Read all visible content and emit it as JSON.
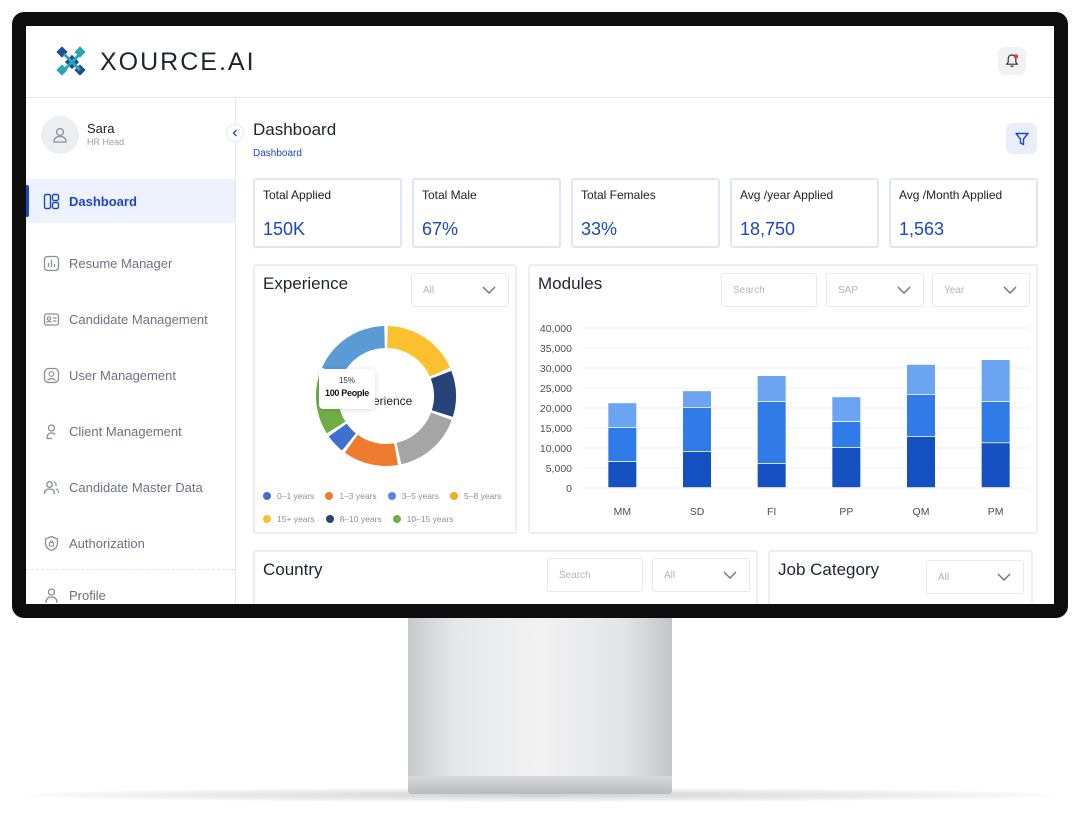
{
  "app": {
    "brand": "XOURCE.AI",
    "colors": {
      "primary": "#1b47c6",
      "logo_dark": "#1d4e8f",
      "logo_teal": "#2aa6b8",
      "notification_dot": "#e53935"
    }
  },
  "header": {
    "notification_icon": "bell-icon"
  },
  "user": {
    "name": "Sara",
    "role": "HR Head"
  },
  "sidebar": {
    "items": [
      {
        "label": "Dashboard",
        "icon": "dashboard-icon",
        "active": true
      },
      {
        "label": "Resume Manager",
        "icon": "chart-document-icon",
        "active": false
      },
      {
        "label": "Candidate Management",
        "icon": "id-card-icon",
        "active": false
      },
      {
        "label": "User Management",
        "icon": "user-circle-icon",
        "active": false
      },
      {
        "label": "Client Management",
        "icon": "user-icon",
        "active": false
      },
      {
        "label": "Candidate Master Data",
        "icon": "users-icon",
        "active": false
      },
      {
        "label": "Authorization",
        "icon": "shield-icon",
        "active": false
      }
    ],
    "profile_label": "Profile"
  },
  "page": {
    "title": "Dashboard",
    "breadcrumb": "Dashboard"
  },
  "stats": [
    {
      "label": "Total Applied",
      "value": "150K"
    },
    {
      "label": "Total Male",
      "value": "67%"
    },
    {
      "label": "Total Females",
      "value": "33%"
    },
    {
      "label": "Avg /year Applied",
      "value": "18,750"
    },
    {
      "label": "Avg /Month Applied",
      "value": "1,563"
    }
  ],
  "experience": {
    "title": "Experience",
    "filter": {
      "value": "All"
    },
    "center_text": "erience",
    "tooltip": {
      "percent": "15%",
      "people": "100 People"
    },
    "legend": [
      {
        "label": "0–1 years",
        "color": "#3f6fcf"
      },
      {
        "label": "1–3 years",
        "color": "#ee7b30"
      },
      {
        "label": "3–5 years",
        "color": "#5b86e5"
      },
      {
        "label": "5–8 years",
        "color": "#f5a623"
      },
      {
        "label": "15+ years",
        "color": "#fbc02d"
      },
      {
        "label": "8–10 years",
        "color": "#264478"
      },
      {
        "label": "10–15 years",
        "color": "#70ad47"
      }
    ]
  },
  "modules": {
    "title": "Modules",
    "search_placeholder": "Search",
    "filter_sap": "SAP",
    "filter_year": "Year"
  },
  "country": {
    "title": "Country",
    "search_placeholder": "Search",
    "filter": "All"
  },
  "job_category": {
    "title": "Job Category",
    "filter": "All"
  },
  "chart_data": [
    {
      "type": "pie",
      "title": "Experience",
      "labels": [
        "15+ years",
        "8–10 years",
        "5–8 years (gray)",
        "1–3 years",
        "0–1 years",
        "10–15 years",
        "3–5 years"
      ],
      "values": [
        18,
        11,
        16,
        13,
        5,
        15,
        18
      ],
      "colors": [
        "#fbc02d",
        "#264478",
        "#a5a5a5",
        "#ee7b30",
        "#3f6fcf",
        "#70ad47",
        "#5b9bd5"
      ]
    },
    {
      "type": "bar",
      "stacked": true,
      "title": "Modules",
      "categories": [
        "MM",
        "SD",
        "FI",
        "PP",
        "QM",
        "PM"
      ],
      "ylim": [
        0,
        40000
      ],
      "yticks": [
        0,
        5000,
        10000,
        15000,
        20000,
        25000,
        30000,
        35000,
        40000
      ],
      "ytick_labels": [
        "0",
        "5,000",
        "10,000",
        "15,000",
        "20,000",
        "25,000",
        "30,000",
        "35,000",
        "40,000"
      ],
      "series": [
        {
          "values": [
            6500,
            9000,
            6000,
            10000,
            12800,
            11200
          ],
          "color": "#1550c0"
        },
        {
          "values": [
            8500,
            11000,
            15500,
            6500,
            10500,
            10300
          ],
          "color": "#2f7be8"
        },
        {
          "values": [
            6200,
            4200,
            6500,
            6200,
            7500,
            10500
          ],
          "color": "#6aa4f2"
        }
      ],
      "grid": true
    }
  ]
}
